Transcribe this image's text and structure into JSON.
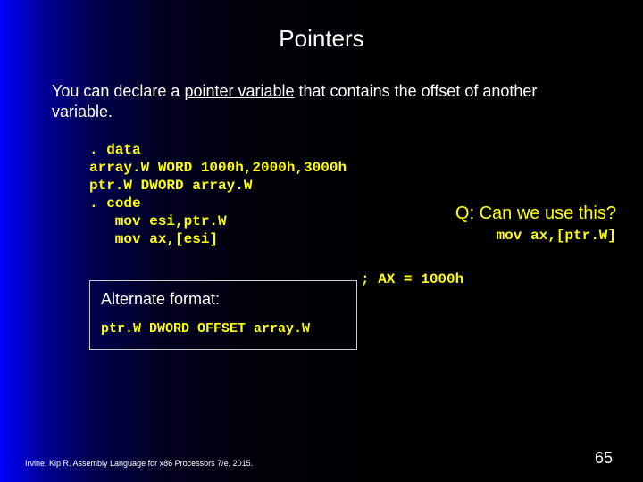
{
  "title": "Pointers",
  "intro_pre": "You can declare a ",
  "intro_underlined": "pointer variable",
  "intro_post": " that contains the offset of another variable.",
  "code": ". data\narray.W WORD 1000h,2000h,3000h\nptr.W DWORD array.W\n. code\n   mov esi,ptr.W\n   mov ax,[esi]",
  "comment": "; AX = 1000h",
  "question": "Q: Can we use this?",
  "question_code": "mov ax,[ptr.W]",
  "alt_label": "Alternate format:",
  "alt_code": "ptr.W DWORD OFFSET array.W",
  "footer": "Irvine, Kip R. Assembly Language for x86 Processors 7/e, 2015.",
  "page": "65"
}
